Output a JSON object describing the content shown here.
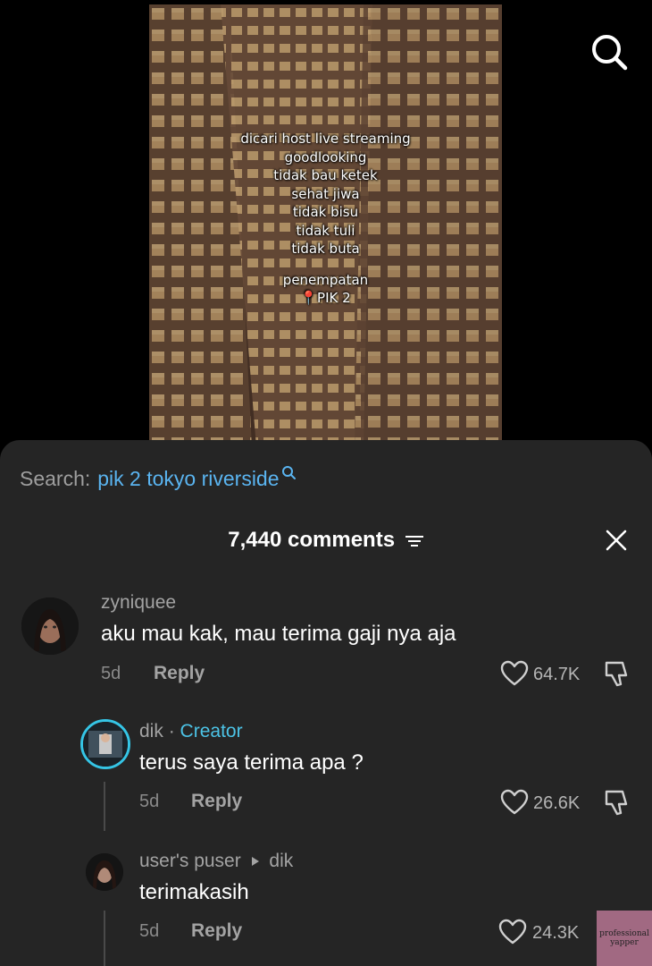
{
  "video": {
    "overlay_lines": [
      "dicari host live streaming",
      "goodlooking",
      "tidak bau ketek",
      "sehat jiwa",
      "tidak bisu",
      "tidak tuli",
      "tidak buta"
    ],
    "placement_label": "penempatan",
    "placement_value": "📍PIK 2",
    "search_icon": "search-icon"
  },
  "search": {
    "label": "Search:",
    "query": "pik 2 tokyo riverside"
  },
  "comments_header": {
    "title": "7,440 comments"
  },
  "comments": [
    {
      "username": "zyniquee",
      "text": "aku mau kak, mau terima gaji nya aja",
      "time": "5d",
      "reply_label": "Reply",
      "likes": "64.7K"
    },
    {
      "username": "dik",
      "separator": "·",
      "role": "Creator",
      "text": "terus saya terima apa ?",
      "time": "5d",
      "reply_label": "Reply",
      "likes": "26.6K"
    },
    {
      "username": "user's puser",
      "reply_to": "dik",
      "text": "terimakasih",
      "time": "5d",
      "reply_label": "Reply",
      "likes": "24.3K"
    }
  ],
  "watermark": {
    "text": "professional yapper"
  },
  "colors": {
    "background": "#000000",
    "sheet": "#252525",
    "accent_blue": "#5ab4f0",
    "creator": "#4cc3e6"
  }
}
